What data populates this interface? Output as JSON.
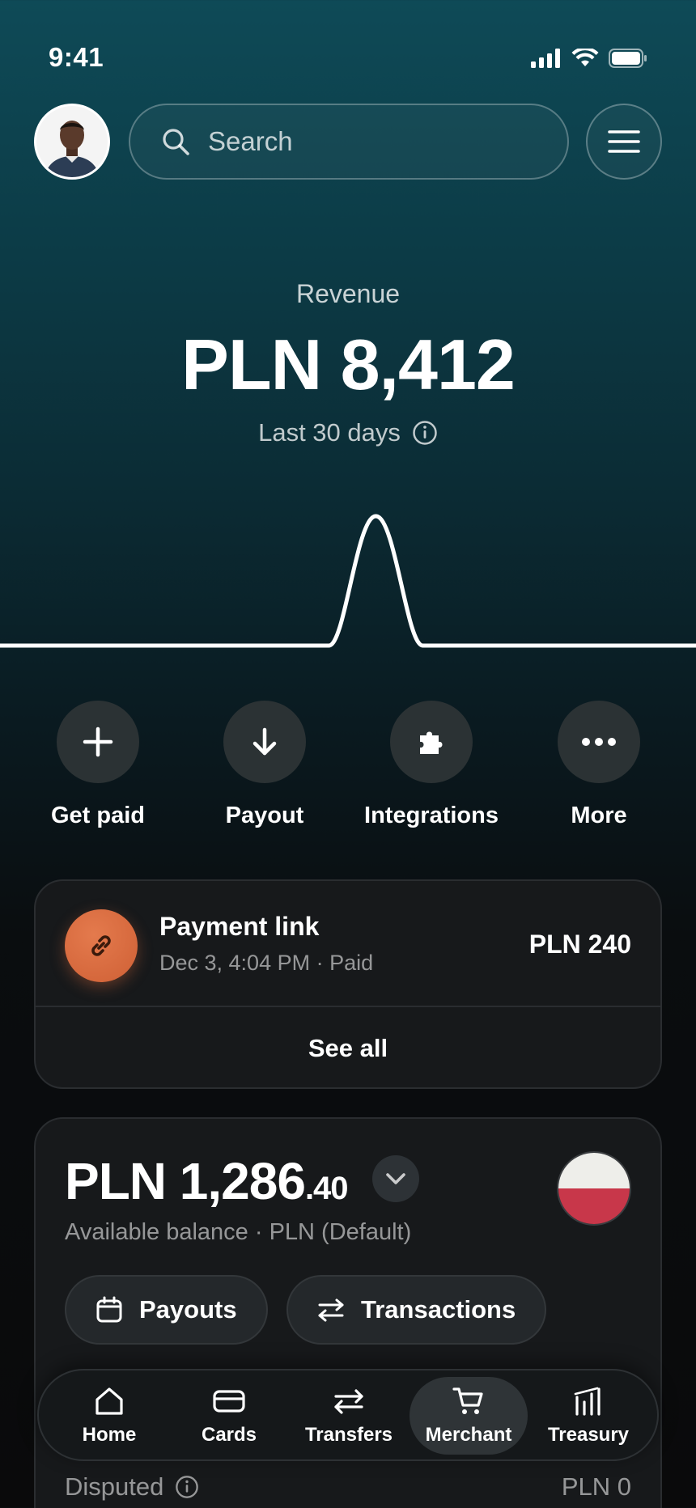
{
  "status_bar": {
    "time": "9:41"
  },
  "search": {
    "placeholder": "Search"
  },
  "revenue": {
    "label": "Revenue",
    "amount": "PLN 8,412",
    "period": "Last 30 days"
  },
  "chart_data": {
    "type": "line",
    "description_points": [
      0,
      0,
      0,
      0,
      0,
      0,
      1,
      0,
      0,
      0,
      0,
      0
    ],
    "peak_relative_position": 0.54
  },
  "actions": [
    {
      "label": "Get paid",
      "icon": "plus-icon"
    },
    {
      "label": "Payout",
      "icon": "arrow-down-icon"
    },
    {
      "label": "Integrations",
      "icon": "puzzle-icon"
    },
    {
      "label": "More",
      "icon": "more-dots-icon"
    }
  ],
  "activity": {
    "title": "Payment link",
    "subtitle": "Dec 3, 4:04 PM · Paid",
    "amount": "PLN 240",
    "see_all": "See all"
  },
  "balance": {
    "amount_main": "PLN 1,286",
    "amount_cents": ".40",
    "subtitle": "Available balance · PLN (Default)",
    "payouts_label": "Payouts",
    "transactions_label": "Transactions",
    "disputed_label": "Disputed",
    "disputed_amount": "PLN 0"
  },
  "tabs": [
    {
      "label": "Home",
      "icon": "home-icon"
    },
    {
      "label": "Cards",
      "icon": "card-icon"
    },
    {
      "label": "Transfers",
      "icon": "transfer-icon"
    },
    {
      "label": "Merchant",
      "icon": "cart-icon",
      "active": true
    },
    {
      "label": "Treasury",
      "icon": "chart-bars-icon"
    }
  ],
  "colors": {
    "accent_orange": "#cf6035",
    "flag_white": "#eeeeea",
    "flag_red": "#c8374a"
  }
}
